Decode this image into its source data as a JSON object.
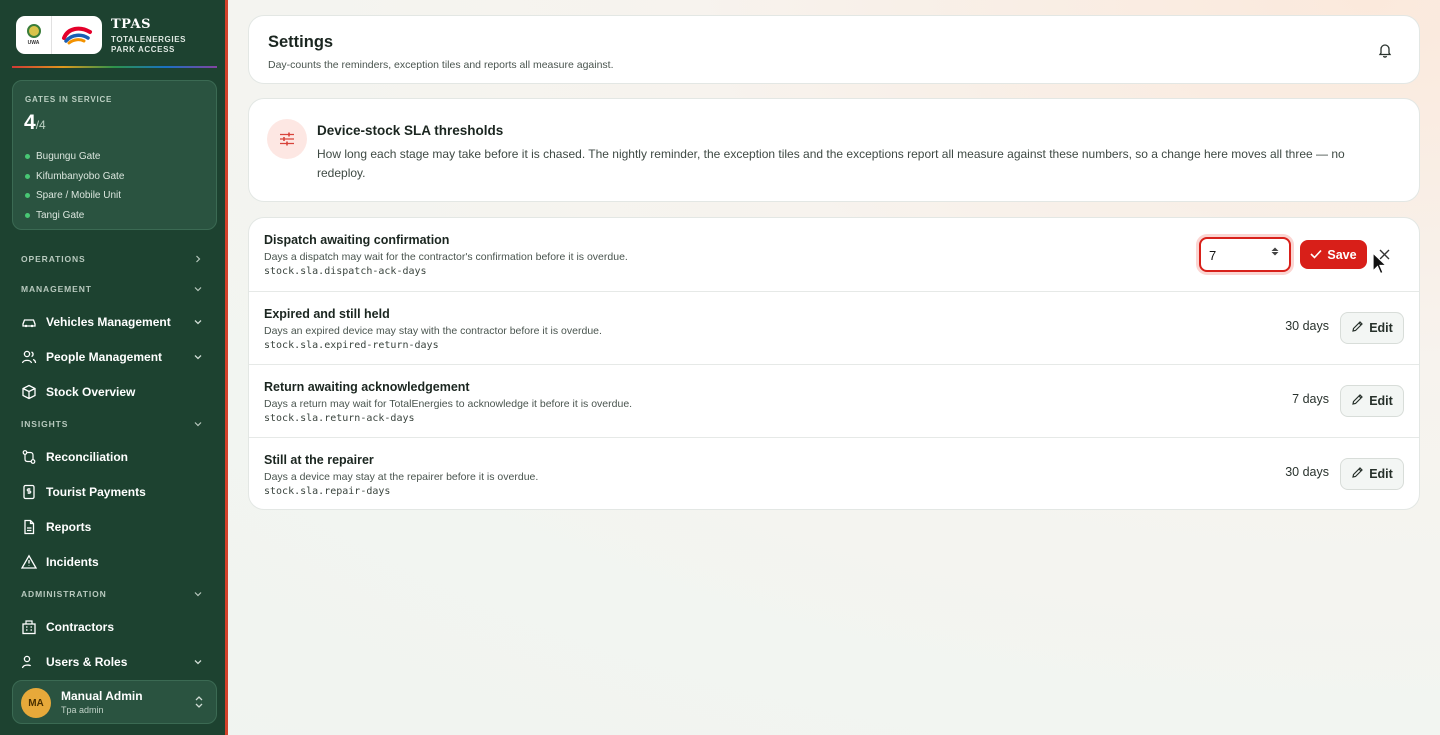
{
  "brand": {
    "title": "TPAS",
    "subtitle_line1": "TOTALENERGIES",
    "subtitle_line2": "PARK ACCESS",
    "uwa_mark": "UWA",
    "logo_icon": "totalenergies-logo-icon"
  },
  "gates": {
    "label": "GATES IN SERVICE",
    "in_service": "4",
    "total": "/4",
    "list": [
      "Bugungu Gate",
      "Kifumbanyobo Gate",
      "Spare / Mobile Unit",
      "Tangi Gate"
    ]
  },
  "nav": {
    "operations": "OPERATIONS",
    "management": "MANAGEMENT",
    "vehicles": "Vehicles Management",
    "people": "People Management",
    "stock": "Stock Overview",
    "insights": "INSIGHTS",
    "reconciliation": "Reconciliation",
    "tourist_payments": "Tourist Payments",
    "reports": "Reports",
    "incidents": "Incidents",
    "administration": "ADMINISTRATION",
    "contractors": "Contractors",
    "users_roles": "Users & Roles"
  },
  "user": {
    "initials": "MA",
    "name": "Manual Admin",
    "role": "Tpa admin"
  },
  "header": {
    "title": "Settings",
    "subtitle": "Day-counts the reminders, exception tiles and reports all measure against."
  },
  "info": {
    "title": "Device-stock SLA thresholds",
    "description": "How long each stage may take before it is chased. The nightly reminder, the exception tiles and the exceptions report all measure against these numbers, so a change here moves all three — no redeploy."
  },
  "sla_rows": [
    {
      "name": "Dispatch awaiting confirmation",
      "description": "Days a dispatch may wait for the contractor's confirmation before it is overdue.",
      "key": "stock.sla.dispatch-ack-days",
      "editing": true,
      "input_value": "7",
      "save_label": "Save"
    },
    {
      "name": "Expired and still held",
      "description": "Days an expired device may stay with the contractor before it is overdue.",
      "key": "stock.sla.expired-return-days",
      "value": "30 days",
      "edit_label": "Edit"
    },
    {
      "name": "Return awaiting acknowledgement",
      "description": "Days a return may wait for TotalEnergies to acknowledge it before it is overdue.",
      "key": "stock.sla.return-ack-days",
      "value": "7 days",
      "edit_label": "Edit"
    },
    {
      "name": "Still at the repairer",
      "description": "Days a device may stay at the repairer before it is overdue.",
      "key": "stock.sla.repair-days",
      "value": "30 days",
      "edit_label": "Edit"
    }
  ],
  "colors": {
    "sidebar": "#1d4230",
    "accent_red": "#d81f19",
    "status_dot": "#48c774"
  }
}
